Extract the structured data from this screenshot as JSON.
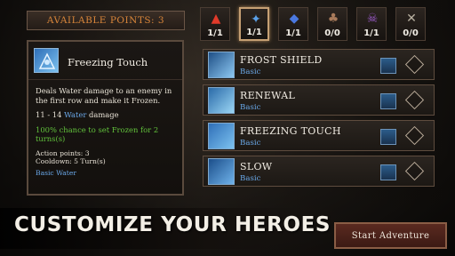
{
  "available_points": "Available points: 3",
  "slots": [
    {
      "icon": "fire-icon",
      "count": "1/1",
      "color": "#e03a2a"
    },
    {
      "icon": "water-spirit-icon",
      "count": "1/1",
      "color": "#5aa0e8",
      "active": true
    },
    {
      "icon": "lightning-icon",
      "count": "1/1",
      "color": "#4a78e0"
    },
    {
      "icon": "beast-icon",
      "count": "0/0",
      "color": "#a87a5a"
    },
    {
      "icon": "skull-icon",
      "count": "1/1",
      "color": "#9a5ac8"
    },
    {
      "icon": "swords-icon",
      "count": "0/0",
      "color": "#b8b0a0"
    }
  ],
  "detail": {
    "title": "Freezing Touch",
    "description": "Deals Water damage to an enemy in the first row and make it Frozen.",
    "damage_range": "11 - 14",
    "damage_type": "Water",
    "damage_suffix": "damage",
    "chance": "100% chance to set Frozen for 2 turns(s)",
    "action_points": "Action points: 3",
    "cooldown": "Cooldown: 5 Turn(s)",
    "tag": "Basic Water"
  },
  "skills": [
    {
      "name": "Frost Shield",
      "type": "Basic",
      "icon": "frost-shield-icon"
    },
    {
      "name": "Renewal",
      "type": "Basic",
      "icon": "renewal-icon"
    },
    {
      "name": "Freezing Touch",
      "type": "Basic",
      "icon": "freezing-touch-icon"
    },
    {
      "name": "Slow",
      "type": "Basic",
      "icon": "slow-icon"
    }
  ],
  "banner": "Customize your heroes",
  "start_button": "Start Adventure"
}
